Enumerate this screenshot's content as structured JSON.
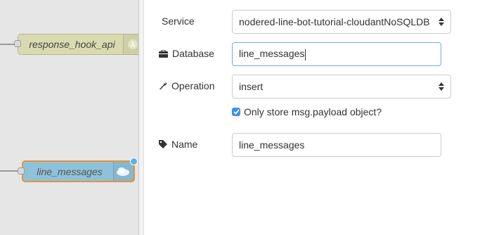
{
  "canvas": {
    "nodes": [
      {
        "label": "response_hook_api",
        "icon": "lambda-icon"
      },
      {
        "label": "line_messages",
        "icon": "cloud-icon"
      }
    ]
  },
  "form": {
    "service": {
      "label": "Service",
      "value": "nodered-line-bot-tutorial-cloudantNoSQLDB"
    },
    "database": {
      "label": "Database",
      "value": "line_messages",
      "icon": "briefcase-icon"
    },
    "operation": {
      "label": "Operation",
      "value": "insert",
      "icon": "wrench-icon"
    },
    "only_payload": {
      "label": "Only store msg.payload object?",
      "checked": true
    },
    "name": {
      "label": "Name",
      "value": "line_messages",
      "icon": "tag-icon"
    }
  },
  "colors": {
    "canvas_bg": "#e6e6e6",
    "function_node": "#dadab0",
    "cloudant_node": "#8fc1d9",
    "selected_outline": "#e8913a",
    "checkbox": "#3d8ff0"
  }
}
